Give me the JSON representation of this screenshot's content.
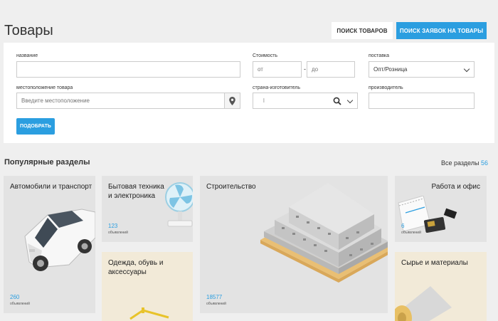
{
  "header": {
    "title": "Товары",
    "tab_goods": "ПОИСК ТОВАРОВ",
    "tab_requests": "ПОИСК ЗАЯВОК НА ТОВАРЫ"
  },
  "form": {
    "name_label": "название",
    "price_label": "Стоимость",
    "price_from_placeholder": "от",
    "price_to_placeholder": "до",
    "delivery_label": "поставка",
    "delivery_value": "Опт/Розница",
    "location_label": "местоположение товара",
    "location_placeholder": "Введите местоположение",
    "country_label": "страна-изготовитель",
    "country_value": "l",
    "maker_label": "производитель",
    "submit_label": "ПОДОБРАТЬ"
  },
  "sections": {
    "title": "Популярные разделы",
    "all_label": "Все разделы",
    "all_count": "56",
    "cards": [
      {
        "title": "Автомобили и транспорт",
        "count": "260",
        "sub": "объявлений"
      },
      {
        "title": "Бытовая техника и электроника",
        "count": "123",
        "sub": "объявлений"
      },
      {
        "title": "Строительство",
        "count": "18577",
        "sub": "объявлений"
      },
      {
        "title": "Работа и офис",
        "count": "6",
        "sub": "объявлений"
      },
      {
        "title": "Одежда, обувь и аксессуары"
      },
      {
        "title": "Сырье и материалы"
      }
    ]
  },
  "colors": {
    "accent": "#2b9ee0",
    "background": "#efefef"
  }
}
